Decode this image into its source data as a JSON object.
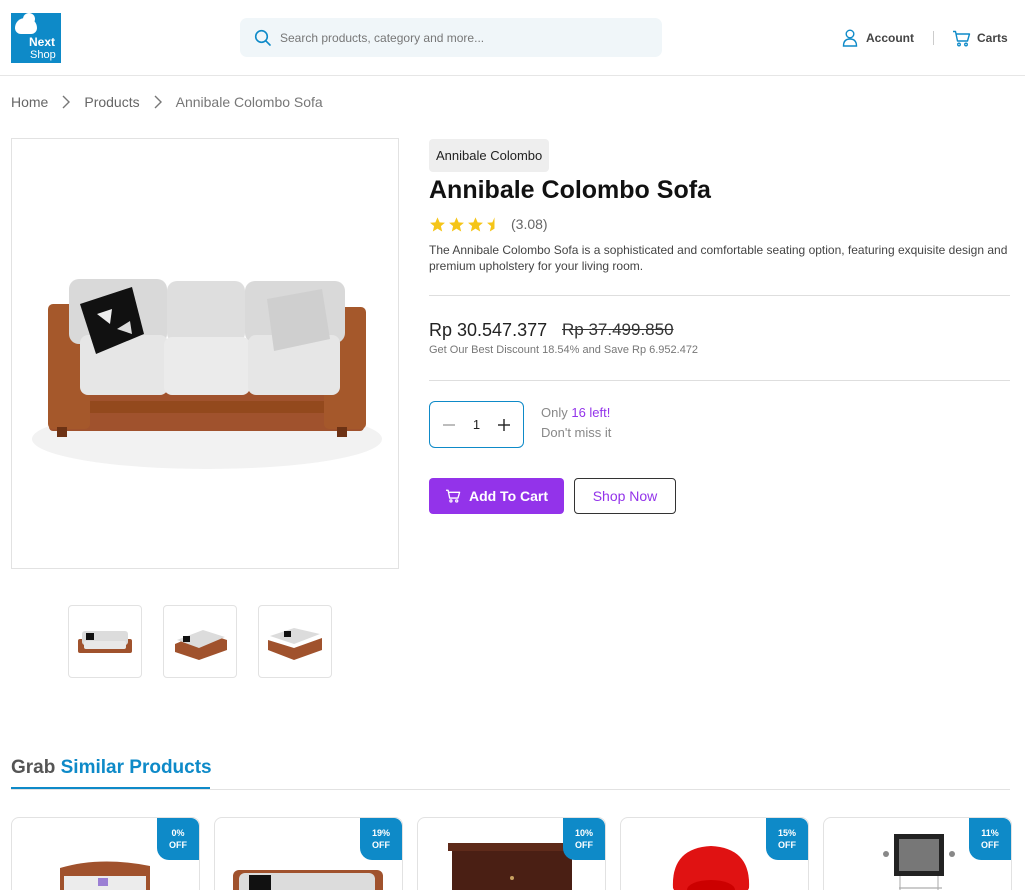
{
  "header": {
    "logo_line1": "Next",
    "logo_line2": "Shop",
    "search_placeholder": "Search products, category and more...",
    "account_label": "Account",
    "carts_label": "Carts"
  },
  "breadcrumb": [
    "Home",
    "Products",
    "Annibale Colombo Sofa"
  ],
  "product": {
    "brand": "Annibale Colombo",
    "title": "Annibale Colombo Sofa",
    "rating": 3.08,
    "rating_text": "(3.08)",
    "description": "The Annibale Colombo Sofa is a sophisticated and comfortable seating option, featuring exquisite design and premium upholstery for your living room.",
    "price": "Rp 30.547.377",
    "old_price": "Rp 37.499.850",
    "discount_text": "Get Our Best Discount 18.54% and Save Rp 6.952.472",
    "quantity": "1",
    "stock_prefix": "Only ",
    "stock_highlight": "16 left!",
    "stock_line2": "Don't miss it",
    "add_to_cart": "Add To Cart",
    "shop_now": "Shop Now"
  },
  "similar": {
    "title_prefix": "Grab ",
    "title_accent": "Similar Products",
    "items": [
      {
        "badge_pct": "0%",
        "badge_off": "OFF"
      },
      {
        "badge_pct": "19%",
        "badge_off": "OFF"
      },
      {
        "badge_pct": "10%",
        "badge_off": "OFF"
      },
      {
        "badge_pct": "15%",
        "badge_off": "OFF"
      },
      {
        "badge_pct": "11%",
        "badge_off": "OFF"
      }
    ]
  },
  "colors": {
    "accent_blue": "#0e8ac8",
    "accent_purple": "#9333ea",
    "star": "#f5c518"
  }
}
